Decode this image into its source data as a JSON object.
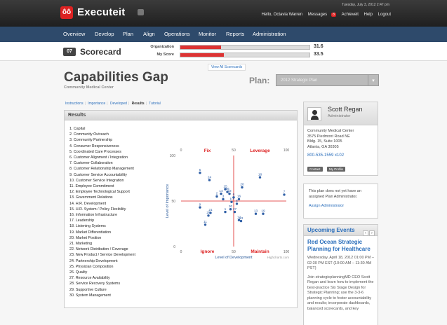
{
  "app": {
    "logo_mark": "ôô",
    "logo_text": "Executeit",
    "date": "Tuesday, July 3, 2012 2:47 pm",
    "user_greeting": "Hello, Octavia Warren",
    "messages_label": "Messages",
    "messages_count": "8",
    "achieveit_label": "Achieveit",
    "help_label": "Help",
    "logout_label": "Logout"
  },
  "nav": [
    "Overview",
    "Develop",
    "Plan",
    "Align",
    "Operations",
    "Monitor",
    "Reports",
    "Administration"
  ],
  "scorecard": {
    "icon_text": "07",
    "title": "Scorecard",
    "org_label": "Organization",
    "org_value": "31.6",
    "org_fraction": 0.316,
    "my_label": "My Score",
    "my_value": "33.5",
    "my_fraction": 0.335,
    "view_all": "View All Scorecards"
  },
  "page": {
    "title": "Capabilities Gap",
    "subtitle": "Community Medical Center",
    "plan_label": "Plan:",
    "plan_value": "2012 Strategic Plan"
  },
  "subtabs": [
    "Instructions",
    "Importance",
    "Developed",
    "Results",
    "Tutorial"
  ],
  "results": {
    "heading": "Results",
    "items": [
      "1. Capital",
      "2. Community Outreach",
      "3. Community Partnership",
      "4. Consumer Responsiveness",
      "5. Coordinated Care Processes",
      "6. Customer Alignment / Integration",
      "7. Customer Collaboration",
      "8. Customer Relationship Management",
      "9. Customer Service Accountability",
      "10. Customer Service Integration",
      "11. Employee Commitment",
      "12. Employee Technological Support",
      "13. Government Relations",
      "14. H.R. Development",
      "15. H.R. System / Policy Flexibility",
      "16. Information Infrastructure",
      "17. Leadership",
      "18. Listening Systems",
      "19. Market Differentiation",
      "20. Market Position",
      "21. Marketing",
      "22. Network Distribution / Coverage",
      "23. New Product / Service Development",
      "24. Partnership Development",
      "25. Physician Composition",
      "26. Quality",
      "27. Resource Availability",
      "28. Service Recovery Systems",
      "29. Supportive Culture",
      "30. System Management"
    ]
  },
  "chart_data": {
    "type": "scatter",
    "xlabel": "Level of Development",
    "ylabel": "Level of Importance",
    "xlim": [
      0,
      100
    ],
    "ylim": [
      0,
      100
    ],
    "x_ticks": [
      "0",
      "50",
      "100"
    ],
    "y_ticks": [
      "0",
      "50",
      "100"
    ],
    "quadrants": {
      "top_left": "Fix",
      "top_right": "Leverage",
      "bottom_left": "Ignore",
      "bottom_right": "Maintain"
    },
    "credit": "Highcharts.com",
    "color": "#2f5fa6",
    "accent": "#d22",
    "points": [
      {
        "label": "5",
        "x": 18,
        "y": 81
      },
      {
        "label": "24",
        "x": 27,
        "y": 73
      },
      {
        "label": "18",
        "x": 75,
        "y": 76
      },
      {
        "label": "7",
        "x": 98,
        "y": 57
      },
      {
        "label": "20",
        "x": 58,
        "y": 65
      },
      {
        "label": "15",
        "x": 42,
        "y": 63
      },
      {
        "label": "26",
        "x": 44,
        "y": 60
      },
      {
        "label": "14",
        "x": 38,
        "y": 58
      },
      {
        "label": "22",
        "x": 46,
        "y": 58
      },
      {
        "label": "2",
        "x": 34,
        "y": 55
      },
      {
        "label": "6",
        "x": 50,
        "y": 54
      },
      {
        "label": "3",
        "x": 40,
        "y": 52
      },
      {
        "label": "16",
        "x": 55,
        "y": 52
      },
      {
        "label": "10",
        "x": 48,
        "y": 49
      },
      {
        "label": "8",
        "x": 53,
        "y": 47
      },
      {
        "label": "9",
        "x": 18,
        "y": 43
      },
      {
        "label": "30",
        "x": 47,
        "y": 41
      },
      {
        "label": "27",
        "x": 51,
        "y": 38
      },
      {
        "label": "21",
        "x": 28,
        "y": 37
      },
      {
        "label": "25",
        "x": 26,
        "y": 34
      },
      {
        "label": "1",
        "x": 42,
        "y": 38
      },
      {
        "label": "13",
        "x": 71,
        "y": 36
      },
      {
        "label": "19",
        "x": 78,
        "y": 36
      },
      {
        "label": "12",
        "x": 55,
        "y": 29
      },
      {
        "label": "23",
        "x": 57,
        "y": 28
      },
      {
        "label": "11",
        "x": 23,
        "y": 24
      }
    ]
  },
  "profile": {
    "name": "Scott Regan",
    "role": "Administrator",
    "address": [
      "Community Medical Center",
      "3575 Piedmont Road NE",
      "Bldg. 15, Suite 1005",
      "Atlanta, GA 30305"
    ],
    "phone": "800-535-1559 x102",
    "contact_btn": "Contact",
    "profile_btn": "My Profile"
  },
  "admin_note": {
    "text": "This plan does not yet have an assigned Plan Administrator.",
    "link": "Assign Administrator"
  },
  "events": {
    "heading": "Upcoming Events",
    "prev": "‹",
    "next": "›",
    "title": "Red Ocean Strategic Planning for Healthcare",
    "time": "Wednesday, April 18, 2012 01:00 PM – 02:30 PM EST (10:00 AM – 11:30 AM PST)",
    "body": "Join strategicplanningMD CEO Scott Regan and learn how to implement the best-practice Six Stage Design for Strategic Planning; use the 3-3-6 planning cycle to foster accountability and results; incorporate dashboards, balanced scorecards, and key"
  }
}
